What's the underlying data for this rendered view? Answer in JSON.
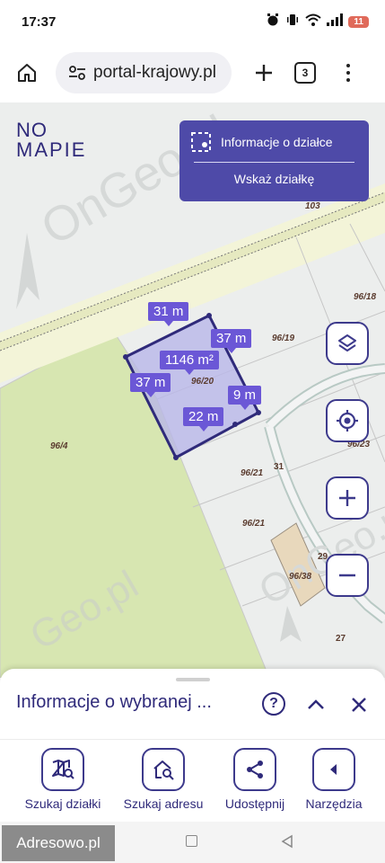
{
  "status_bar": {
    "time": "17:37",
    "battery": "11"
  },
  "browser": {
    "url": "portal-krajowy.pl",
    "tab_count": "3"
  },
  "logo": {
    "line1": "NO",
    "line2": "MAPIE"
  },
  "watermarks": [
    "OnGeo.pl",
    "OnGeo.pl",
    "Geo.pl"
  ],
  "info_panel": {
    "title": "Informacje o działce",
    "action": "Wskaż działkę"
  },
  "map_labels": {
    "road": "103",
    "p96_18": "96/18",
    "p96_19": "96/19",
    "p96_20": "96/20",
    "p96_4": "96/4",
    "p96_21a": "96/21",
    "p96_21b": "96/21",
    "p96_23": "96/23",
    "p96_38": "96/38",
    "n31": "31",
    "n29": "29",
    "n27": "27"
  },
  "measurements": {
    "top": "31 m",
    "right": "37 m",
    "area": "1146 m²",
    "left": "37 m",
    "short": "9 m",
    "bottom": "22 m"
  },
  "sheet": {
    "title": "Informacje o wybranej ...",
    "help_symbol": "?"
  },
  "tools": [
    {
      "label": "Szukaj działki",
      "icon": "map-search-icon"
    },
    {
      "label": "Szukaj adresu",
      "icon": "home-search-icon"
    },
    {
      "label": "Udostępnij",
      "icon": "share-icon"
    },
    {
      "label": "Narzędzia",
      "icon": "tools-arrow-icon"
    }
  ],
  "nav": {
    "watermark": "Adresowo.pl"
  },
  "colors": {
    "accent": "#3d3a8c",
    "panel": "#4e4aa8",
    "measure": "#6b57d6",
    "parcel_fill": "#b9b7e8",
    "green_area": "#d7e6b1"
  }
}
